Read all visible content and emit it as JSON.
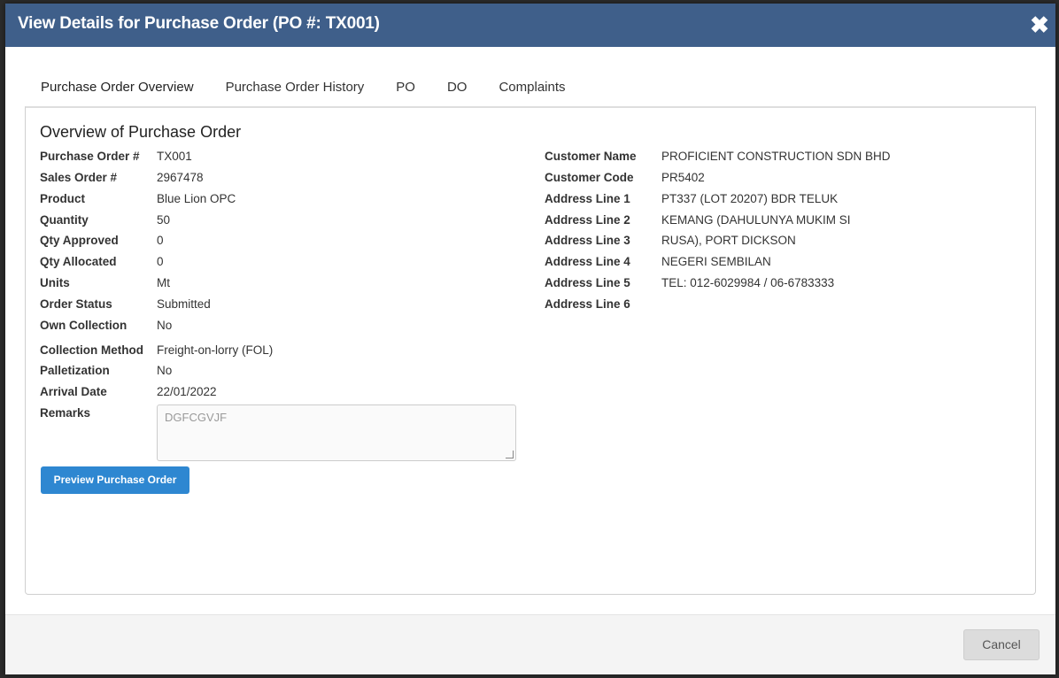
{
  "modal": {
    "title": "View Details for Purchase Order (PO #: TX001)",
    "close_glyph": "✖"
  },
  "tabs": [
    {
      "label": "Purchase Order Overview",
      "active": true
    },
    {
      "label": "Purchase Order History",
      "active": false
    },
    {
      "label": "PO",
      "active": false
    },
    {
      "label": "DO",
      "active": false
    },
    {
      "label": "Complaints",
      "active": false
    }
  ],
  "overview": {
    "title": "Overview of Purchase Order",
    "left": [
      {
        "label": "Purchase Order #",
        "value": "TX001"
      },
      {
        "label": "Sales Order #",
        "value": "2967478"
      },
      {
        "label": "Product",
        "value": "Blue Lion OPC"
      },
      {
        "label": "Quantity",
        "value": "50"
      },
      {
        "label": "Qty Approved",
        "value": "0"
      },
      {
        "label": "Qty Allocated",
        "value": "0"
      },
      {
        "label": "Units",
        "value": "Mt"
      },
      {
        "label": "Order Status",
        "value": "Submitted"
      },
      {
        "label": "Own Collection",
        "value": "No"
      },
      {
        "label": "Collection Method",
        "value": "Freight-on-lorry (FOL)"
      },
      {
        "label": "Palletization",
        "value": "No"
      },
      {
        "label": "Arrival Date",
        "value": "22/01/2022"
      }
    ],
    "remarks_label": "Remarks",
    "remarks_value": "DGFCGVJF",
    "right": [
      {
        "label": "Customer Name",
        "value": "PROFICIENT CONSTRUCTION SDN BHD"
      },
      {
        "label": "Customer Code",
        "value": "PR5402"
      },
      {
        "label": "Address Line 1",
        "value": "PT337 (LOT 20207) BDR TELUK"
      },
      {
        "label": "Address Line 2",
        "value": "KEMANG (DAHULUNYA MUKIM SI"
      },
      {
        "label": "Address Line 3",
        "value": "RUSA), PORT DICKSON"
      },
      {
        "label": "Address Line 4",
        "value": "NEGERI SEMBILAN"
      },
      {
        "label": "Address Line 5",
        "value": "TEL: 012-6029984 / 06-6783333"
      },
      {
        "label": "Address Line 6",
        "value": ""
      }
    ],
    "preview_button": "Preview Purchase Order"
  },
  "footer": {
    "cancel_label": "Cancel"
  },
  "colors": {
    "header": "#3f5f8a",
    "primary_button": "#2e87d1",
    "cancel_button": "#dcdcdc"
  }
}
